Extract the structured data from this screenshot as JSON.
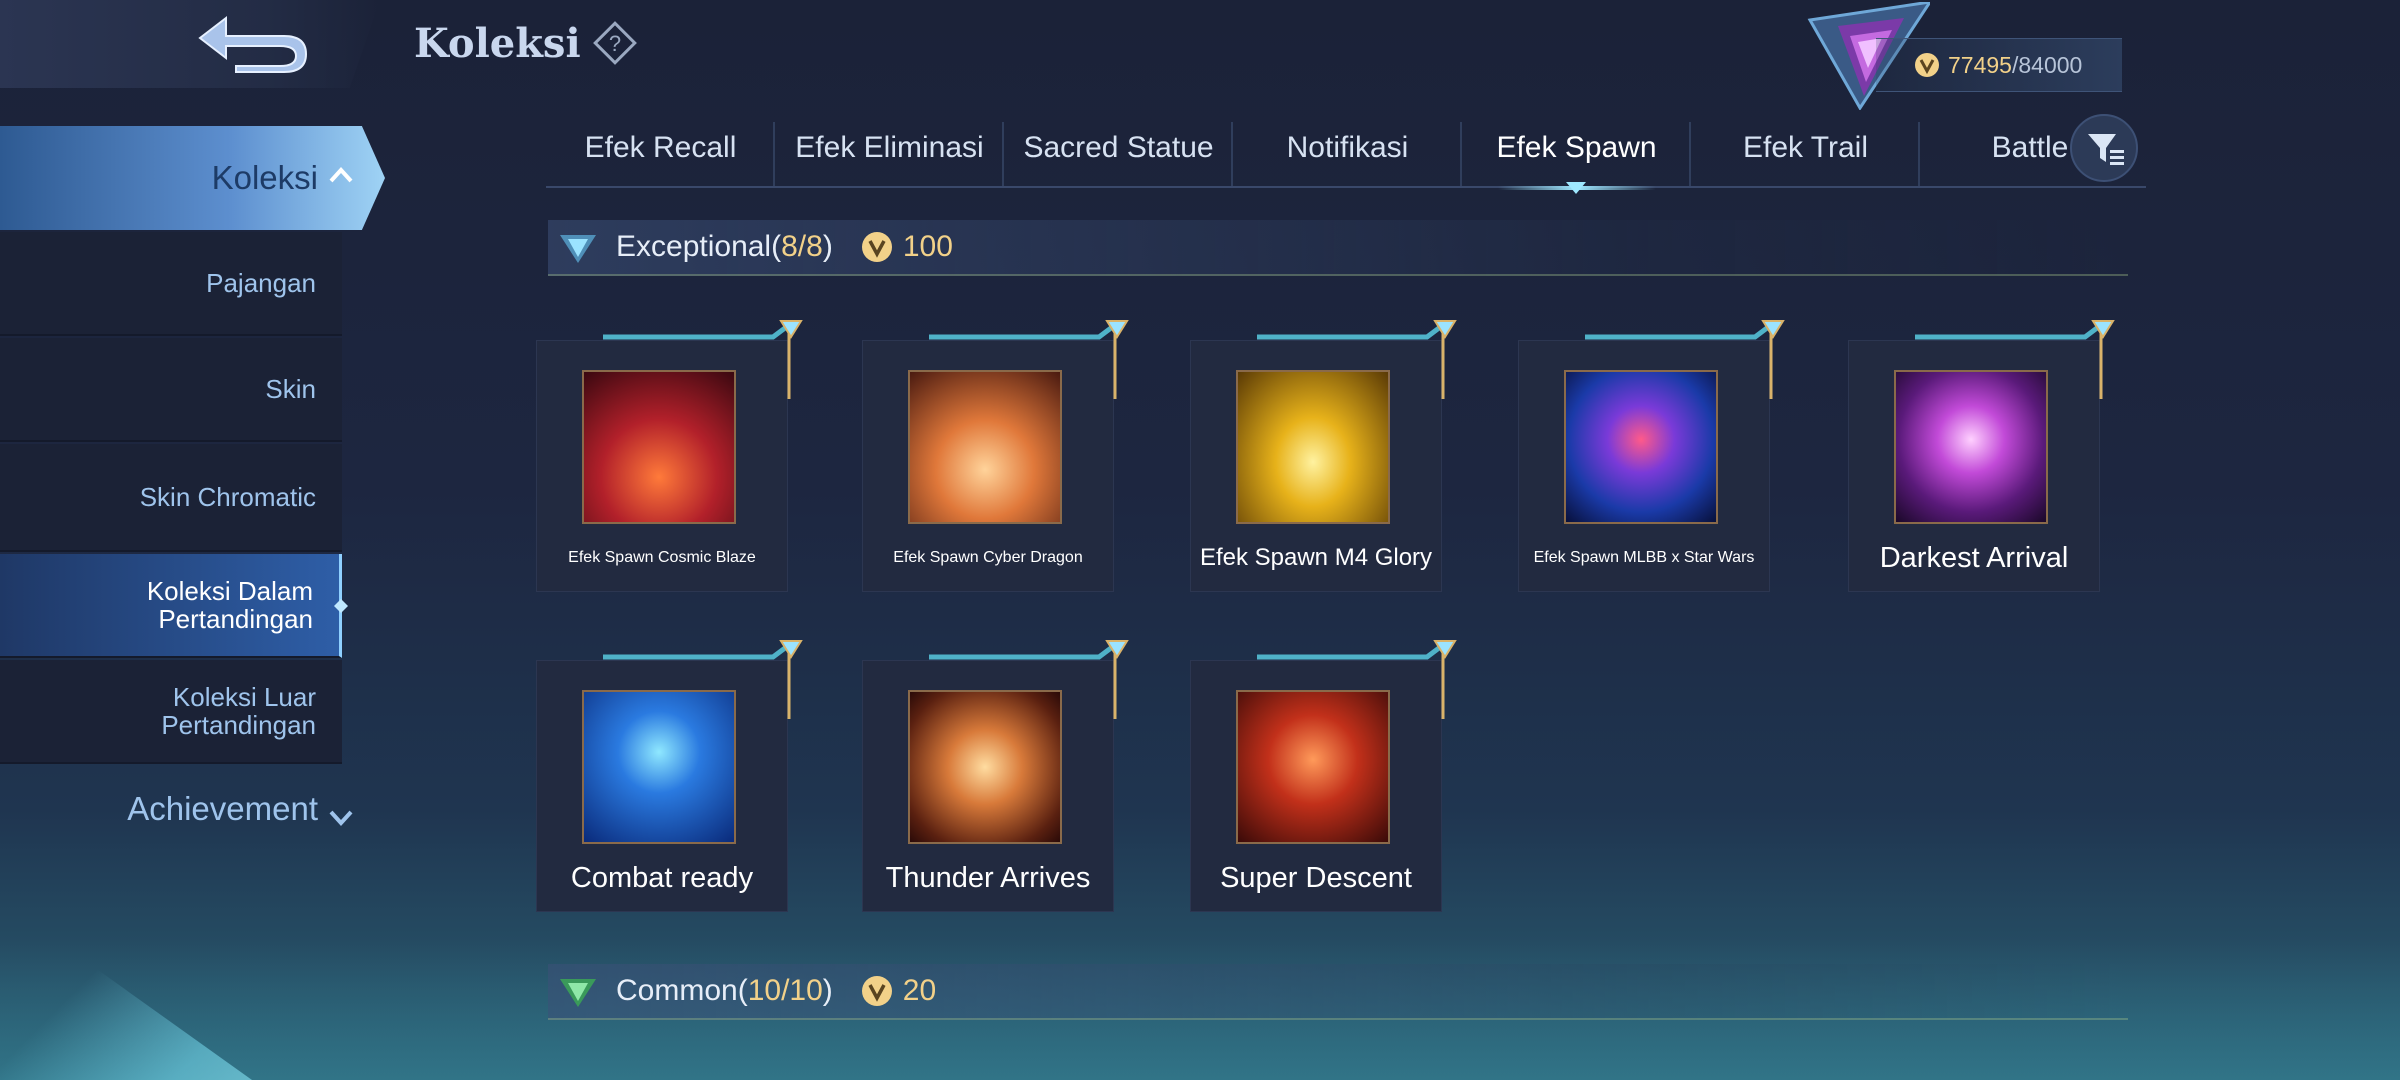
{
  "header": {
    "title": "Koleksi",
    "points_current": "77495",
    "points_separator": "/",
    "points_max": "84000"
  },
  "sidebar": {
    "active_label": "Koleksi",
    "items": [
      {
        "label": "Pajangan"
      },
      {
        "label": "Skin"
      },
      {
        "label": "Skin Chromatic"
      },
      {
        "label": "Koleksi Dalam\nPertandingan"
      },
      {
        "label": "Koleksi Luar\nPertandingan"
      }
    ],
    "achievement_label": "Achievement"
  },
  "tabs": [
    {
      "label": "Efek Recall"
    },
    {
      "label": "Efek Eliminasi"
    },
    {
      "label": "Sacred Statue"
    },
    {
      "label": "Notifikasi"
    },
    {
      "label": "Efek Spawn"
    },
    {
      "label": "Efek Trail"
    },
    {
      "label": "Battle"
    }
  ],
  "sections": [
    {
      "name": "Exceptional",
      "open": "(",
      "count": "8/8",
      "close": ")",
      "reward": "100"
    },
    {
      "name": "Common",
      "open": "(",
      "count": "10/10",
      "close": ")",
      "reward": "20"
    }
  ],
  "items": [
    {
      "label": "Efek Spawn Cosmic Blaze",
      "icon": "cosmic-blaze-thumbnail"
    },
    {
      "label": "Efek Spawn Cyber Dragon",
      "icon": "cyber-dragon-thumbnail"
    },
    {
      "label": "Efek Spawn M4 Glory",
      "icon": "m4-glory-thumbnail"
    },
    {
      "label": "Efek Spawn MLBB x Star Wars",
      "icon": "star-wars-thumbnail"
    },
    {
      "label": "Darkest Arrival",
      "icon": "darkest-arrival-thumbnail"
    },
    {
      "label": "Combat ready",
      "icon": "combat-ready-thumbnail"
    },
    {
      "label": "Thunder Arrives",
      "icon": "thunder-arrives-thumbnail"
    },
    {
      "label": "Super Descent",
      "icon": "super-descent-thumbnail"
    }
  ],
  "colors": {
    "gold": "#f2d189",
    "accent_blue": "#8fd0ff",
    "background": "#1d2640"
  }
}
